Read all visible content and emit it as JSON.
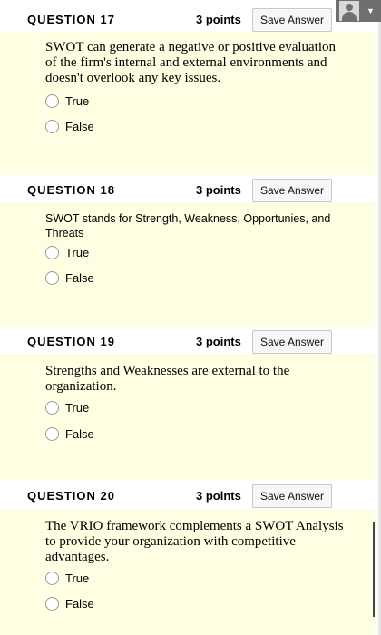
{
  "questions": [
    {
      "title": "QUESTION 17",
      "points": "3 points",
      "save_label": "Save Answer",
      "text": "SWOT can generate a negative or positive evaluation of the firm's internal and external environments and doesn't overlook any key issues.",
      "options": [
        "True",
        "False"
      ]
    },
    {
      "title": "QUESTION 18",
      "points": "3 points",
      "save_label": "Save Answer",
      "text": "SWOT stands for Strength, Weakness, Opportunies, and Threats",
      "options": [
        "True",
        "False"
      ]
    },
    {
      "title": "QUESTION 19",
      "points": "3 points",
      "save_label": "Save Answer",
      "text": "Strengths and Weaknesses are external to the organization.",
      "options": [
        "True",
        "False"
      ]
    },
    {
      "title": "QUESTION 20",
      "points": "3 points",
      "save_label": "Save Answer",
      "text": "The VRIO framework complements a SWOT Analysis to provide your organization with competitive advantages.",
      "options": [
        "True",
        "False"
      ]
    }
  ],
  "colors": {
    "question_background": "#fefee2",
    "header_background": "#ffffff",
    "user_menu_background": "#6f6f6f"
  },
  "icons": {
    "user_menu": "user-avatar-icon",
    "user_menu_caret": "caret-down-icon"
  }
}
